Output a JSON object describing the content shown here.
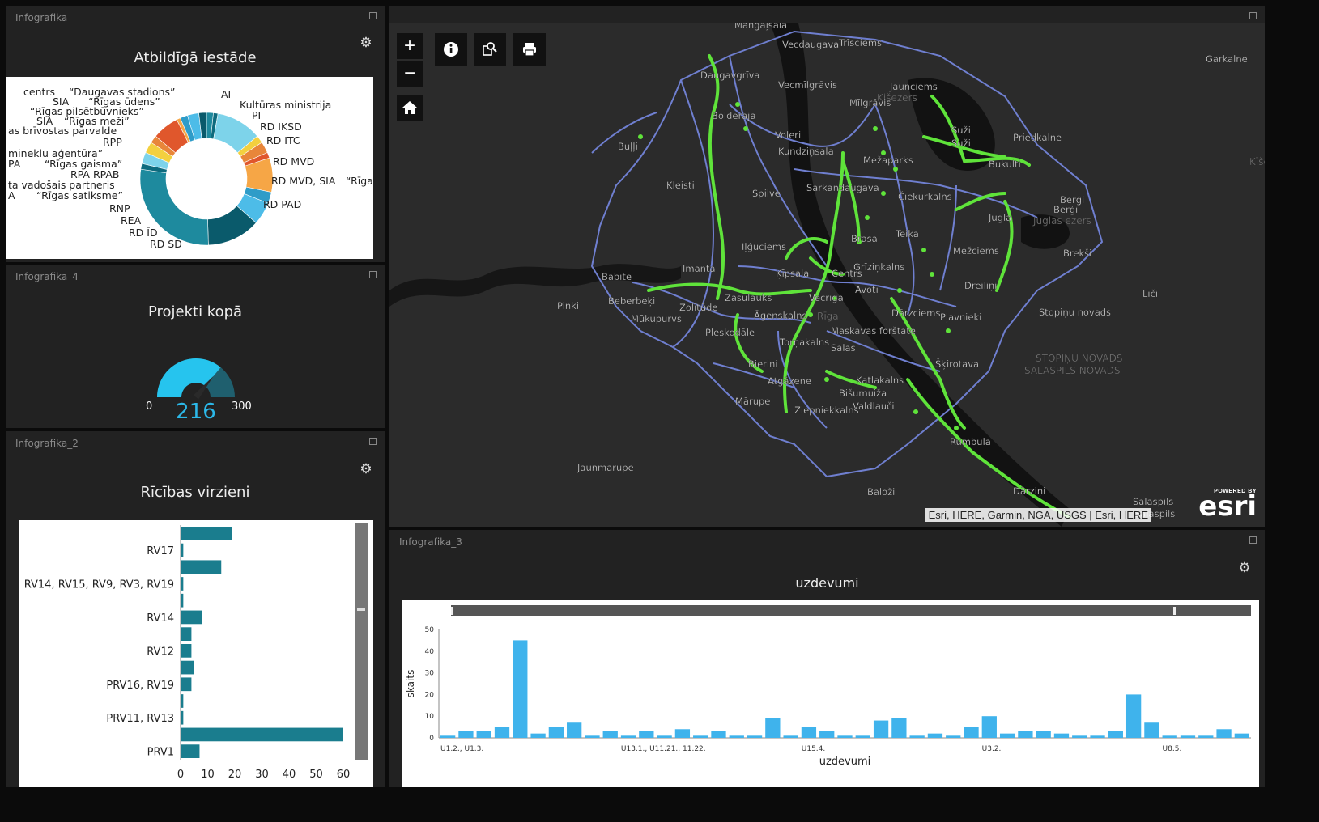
{
  "panels": {
    "p1": {
      "caption": "Infografika",
      "title": "Atbildīgā iestāde"
    },
    "p4": {
      "caption": "Infografika_4",
      "title": "Projekti kopā"
    },
    "p2": {
      "caption": "Infografika_2",
      "title": "Rīcības virzieni"
    },
    "p3": {
      "caption": "Infografika_3",
      "title": "uzdevumi"
    }
  },
  "gauge": {
    "value": 216,
    "value_label": "216",
    "min_label": "0",
    "max_label": "300",
    "min": 0,
    "max": 300
  },
  "donut": {
    "labels_left": [
      "centrs",
      "“Daugavas stadions”",
      "SIA",
      "“Rīgas ūdens”",
      "“Rīgas pilsētbūvnieks”",
      "SIA",
      "“Rīgas meži”",
      "as brīvostas pārvalde",
      "RPP",
      "mineklu aģentūra”",
      "PA",
      "“Rīgas gaisma”",
      "RPA RPAB",
      "ta vadošais partneris",
      "A",
      "“Rīgas satiksme”",
      "RNP",
      "REA",
      "RD ĪD",
      "RD SD"
    ],
    "labels_right": [
      "AI",
      "Kultūras ministrija",
      "PI",
      "RD IKSD",
      "RD ITC",
      "RD MVD",
      "RD MVD, SIA",
      "“Rīga",
      "RD PAD"
    ],
    "colors": [
      "#1e8a9e",
      "#0e6b7e",
      "#7dd3ea",
      "#f3d03f",
      "#e8863a",
      "#e0572c",
      "#f6a646",
      "#2f9cc8",
      "#4dbce8",
      "#0a5a6b"
    ]
  },
  "chart_data": [
    {
      "type": "bar",
      "title": "Rīcības virzieni",
      "orientation": "horizontal",
      "categories": [
        "PRV1",
        "",
        "PRV11, RV13",
        "",
        "PRV16, RV19",
        "",
        "RV12",
        "",
        "RV14",
        "",
        "RV14, RV15, RV9, RV3, RV19",
        "",
        "RV17",
        ""
      ],
      "values": [
        7,
        60,
        1,
        1,
        4,
        5,
        4,
        4,
        8,
        1,
        1,
        15,
        1,
        19
      ],
      "xlim": [
        0,
        60
      ],
      "xticks": [
        "0",
        "10",
        "20",
        "30",
        "40",
        "50",
        "60"
      ],
      "color": "#1a7d8e"
    },
    {
      "type": "bar",
      "title": "uzdevumi",
      "xlabel": "uzdevumi",
      "ylabel": "skaits",
      "ylim": [
        0,
        50
      ],
      "yticks": [
        "0",
        "10",
        "20",
        "30",
        "40",
        "50"
      ],
      "xtick_labels": [
        "U1.2., U1.3.",
        "U13.1., U11.21., 11.22.",
        "U15.4.",
        "U3.2.",
        "U8.5."
      ],
      "values": [
        1,
        3,
        3,
        5,
        45,
        2,
        5,
        7,
        1,
        3,
        1,
        3,
        1,
        4,
        1,
        3,
        1,
        1,
        9,
        1,
        5,
        3,
        1,
        1,
        8,
        9,
        1,
        2,
        1,
        5,
        10,
        2,
        3,
        3,
        2,
        1,
        1,
        3,
        20,
        7,
        1,
        1,
        1,
        4,
        2
      ],
      "color": "#3fb3ec"
    }
  ],
  "map": {
    "labels": [
      "Mangaļsala",
      "Vecdaugava",
      "Trīsciems",
      "Garkalne",
      "Daugavgrīva",
      "Vecmīlgrāvis",
      "Jaunciems",
      "Kišezers",
      "Mīlgrāvis",
      "Bolderāja",
      "Voleri",
      "Suži",
      "Suži",
      "Priedkalne",
      "Buļļi",
      "Kundziņsala",
      "Mežaparks",
      "Bukulti",
      "Ķīšezers",
      "Kleisti",
      "Spilve",
      "Sarkandaugava",
      "Čiekurkalns",
      "Berģi",
      "Berģi",
      "Jugla",
      "Juglas ezers",
      "Teika",
      "Iļģuciems",
      "Brasa",
      "Mežciems",
      "Brekši",
      "Babīte",
      "Imanta",
      "Ķīpsala",
      "Centrs",
      "Grīziņkalns",
      "Pinki",
      "Beberbeķi",
      "Zolitūde",
      "Zasulauks",
      "Vecrīga",
      "Rīga",
      "Avoti",
      "Dreiliņi",
      "Līči",
      "Mūkupurvs",
      "Āgenskalns",
      "Dārzciems",
      "Pļavnieki",
      "Stopiņu novads",
      "Pleskodāle",
      "Maskavas forštate",
      "Torņakalns",
      "Salas",
      "STOPIŅU NOVADS",
      "SALASPILS NOVADS",
      "Bieriņi",
      "Šķirotava",
      "Atgāzene",
      "Katlakalns",
      "Bišumuiža",
      "Mārupe",
      "Valdlauči",
      "Ziepniekkalns",
      "Rumbula",
      "Jaunmārupe",
      "Baloži",
      "Dārziņi",
      "Salaspils",
      "Salaspils"
    ],
    "attribution": "Esri, HERE, Garmin, NGA, USGS | Esri, HERE",
    "powered_by": "POWERED BY",
    "esri_logo": "esri"
  },
  "icons": {
    "zoom_in": "plus-icon",
    "zoom_out": "minus-icon",
    "home": "home-icon",
    "info": "info-icon",
    "search": "search-icon",
    "print": "print-icon",
    "settings": "gear-icon"
  }
}
